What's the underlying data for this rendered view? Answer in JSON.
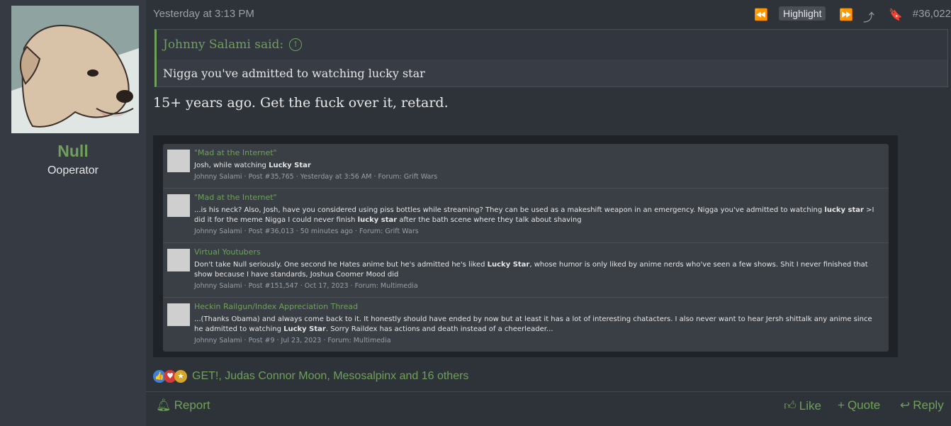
{
  "user": {
    "name": "Null",
    "title": "Ooperator"
  },
  "post": {
    "timestamp": "Yesterday at 3:13 PM",
    "highlight_label": "Highlight",
    "number": "#36,022",
    "quote_author": "Johnny Salami said:",
    "quote_text": "Nigga you've admitted to watching lucky star",
    "message": "15+ years ago. Get the fuck over it, retard."
  },
  "search_results": [
    {
      "title": "\"Mad at the Internet\"",
      "text": "Josh, while watching <b>Lucky Star</b>",
      "meta": "Johnny Salami · Post #35,765 · Yesterday at 3:56 AM · Forum: Grift Wars"
    },
    {
      "title": "\"Mad at the Internet\"",
      "text": "...is his neck? Also, Josh, have you considered using piss bottles while streaming? They can be used as a makeshift weapon in an emergency. Nigga you've admitted to watching <b>lucky star</b> >I did it for the meme Nigga I could never finish <b>lucky star</b> after the bath scene where they talk about shaving",
      "meta": "Johnny Salami · Post #36,013 · 50 minutes ago · Forum: Grift Wars"
    },
    {
      "title": "Virtual Youtubers",
      "text": "Don't take Null seriously. One second he Hates anime but he's admitted he's liked <b>Lucky Star</b>, whose humor is only liked by anime nerds who've seen a few shows. Shit I never finished that show because I have standards, Joshua Coomer Mood did",
      "meta": "Johnny Salami · Post #151,547 · Oct 17, 2023 · Forum: Multimedia"
    },
    {
      "title": "Heckin Railgun/Index Appreciation Thread",
      "text": "...(Thanks Obama) and always come back to it. It honestly should have ended by now but at least it has a lot of interesting chatacters. I also never want to hear Jersh shittalk any anime since he admitted to watching <b>Lucky Star</b>. Sorry Raildex has actions and death instead of a cheerleader...",
      "meta": "Johnny Salami · Post #9 · Jul 23, 2023 · Forum: Multimedia"
    }
  ],
  "reactions": {
    "text": "GET!, Judas Connor Moon, Mesosalpinx and 16 others"
  },
  "footer": {
    "report": "Report",
    "like": "Like",
    "quote": "Quote",
    "reply": "Reply"
  },
  "icons": {
    "reactions": [
      "thumbs-up-icon",
      "heart-icon",
      "medal-icon"
    ]
  },
  "colors": {
    "accent": "#6fa15a",
    "background": "#2e3239",
    "sidebar": "#363b43"
  }
}
